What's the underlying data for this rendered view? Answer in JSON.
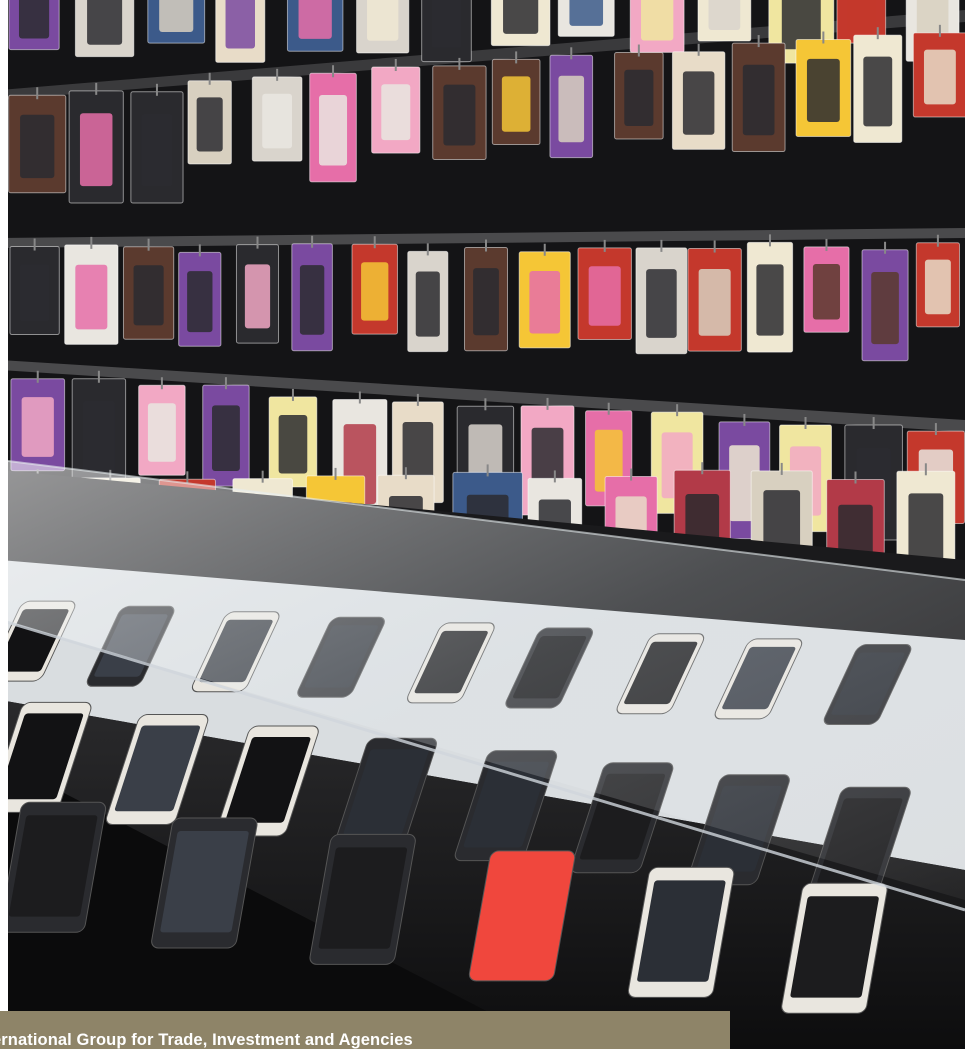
{
  "caption": {
    "text": "ernational Group for Trade, Investment and Agencies"
  },
  "scene": {
    "wall_color": "#141416",
    "pack_colors": [
      "#e9e6e0",
      "#f5c636",
      "#e66ea8",
      "#2a2a2e",
      "#d9d4cc",
      "#c4382c",
      "#7a4aa0",
      "#f2a8c4",
      "#d8d0c0",
      "#b23a48",
      "#3c5a8a",
      "#efe8d2",
      "#f0e6a0",
      "#5b3a2e",
      "#e8dcc8"
    ],
    "phone_screen_colors": [
      "#1c1c1e",
      "#2b2f36",
      "#3a3f48",
      "#121214"
    ],
    "accent_phone_color": "#f0473d"
  }
}
